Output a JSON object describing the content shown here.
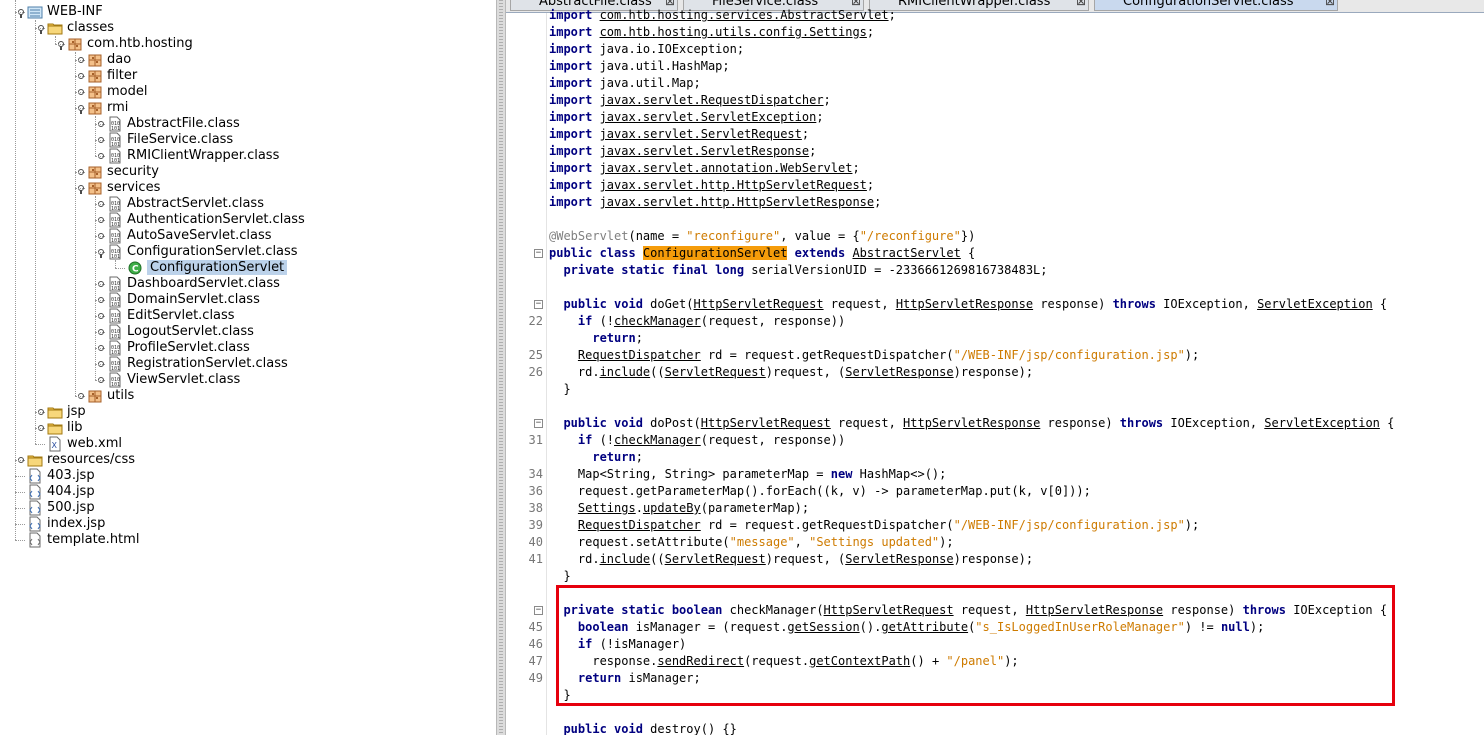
{
  "tree": [
    {
      "label": "WEB-INF",
      "icon": "webinf-folder-icon",
      "depth": 0,
      "state": "open"
    },
    {
      "label": "classes",
      "icon": "folder-icon",
      "depth": 1,
      "state": "open"
    },
    {
      "label": "com.htb.hosting",
      "icon": "package-icon",
      "depth": 2,
      "state": "open"
    },
    {
      "label": "dao",
      "icon": "package-icon",
      "depth": 3,
      "state": "closed"
    },
    {
      "label": "filter",
      "icon": "package-icon",
      "depth": 3,
      "state": "closed"
    },
    {
      "label": "model",
      "icon": "package-icon",
      "depth": 3,
      "state": "closed"
    },
    {
      "label": "rmi",
      "icon": "package-icon",
      "depth": 3,
      "state": "open"
    },
    {
      "label": "AbstractFile.class",
      "icon": "class-file-icon",
      "depth": 4,
      "state": "closed"
    },
    {
      "label": "FileService.class",
      "icon": "class-file-icon",
      "depth": 4,
      "state": "closed"
    },
    {
      "label": "RMIClientWrapper.class",
      "icon": "class-file-icon",
      "depth": 4,
      "state": "closed"
    },
    {
      "label": "security",
      "icon": "package-icon",
      "depth": 3,
      "state": "closed"
    },
    {
      "label": "services",
      "icon": "package-icon",
      "depth": 3,
      "state": "open"
    },
    {
      "label": "AbstractServlet.class",
      "icon": "class-file-icon",
      "depth": 4,
      "state": "closed"
    },
    {
      "label": "AuthenticationServlet.class",
      "icon": "class-file-icon",
      "depth": 4,
      "state": "closed"
    },
    {
      "label": "AutoSaveServlet.class",
      "icon": "class-file-icon",
      "depth": 4,
      "state": "closed"
    },
    {
      "label": "ConfigurationServlet.class",
      "icon": "class-file-icon",
      "depth": 4,
      "state": "open"
    },
    {
      "label": "ConfigurationServlet",
      "icon": "class-icon",
      "depth": 5,
      "state": "leaf",
      "selected": true
    },
    {
      "label": "DashboardServlet.class",
      "icon": "class-file-icon",
      "depth": 4,
      "state": "closed"
    },
    {
      "label": "DomainServlet.class",
      "icon": "class-file-icon",
      "depth": 4,
      "state": "closed"
    },
    {
      "label": "EditServlet.class",
      "icon": "class-file-icon",
      "depth": 4,
      "state": "closed"
    },
    {
      "label": "LogoutServlet.class",
      "icon": "class-file-icon",
      "depth": 4,
      "state": "closed"
    },
    {
      "label": "ProfileServlet.class",
      "icon": "class-file-icon",
      "depth": 4,
      "state": "closed"
    },
    {
      "label": "RegistrationServlet.class",
      "icon": "class-file-icon",
      "depth": 4,
      "state": "closed"
    },
    {
      "label": "ViewServlet.class",
      "icon": "class-file-icon",
      "depth": 4,
      "state": "closed"
    },
    {
      "label": "utils",
      "icon": "package-icon",
      "depth": 3,
      "state": "closed"
    },
    {
      "label": "jsp",
      "icon": "folder-icon",
      "depth": 1,
      "state": "closed"
    },
    {
      "label": "lib",
      "icon": "folder-icon",
      "depth": 1,
      "state": "closed"
    },
    {
      "label": "web.xml",
      "icon": "xml-file-icon",
      "depth": 1,
      "state": "leaf"
    },
    {
      "label": "resources/css",
      "icon": "folder-icon",
      "depth": 0,
      "state": "closed"
    },
    {
      "label": "403.jsp",
      "icon": "jsp-file-icon",
      "depth": 0,
      "state": "leaf"
    },
    {
      "label": "404.jsp",
      "icon": "jsp-file-icon",
      "depth": 0,
      "state": "leaf"
    },
    {
      "label": "500.jsp",
      "icon": "jsp-file-icon",
      "depth": 0,
      "state": "leaf"
    },
    {
      "label": "index.jsp",
      "icon": "jsp-file-icon",
      "depth": 0,
      "state": "leaf"
    },
    {
      "label": "template.html",
      "icon": "html-file-icon",
      "depth": 0,
      "state": "leaf"
    }
  ],
  "tabs": [
    {
      "label": "AbstractFile.class",
      "close": "⊠",
      "active": false
    },
    {
      "label": "FileService.class",
      "close": "⊠",
      "active": false
    },
    {
      "label": "RMIClientWrapper.class",
      "close": "⊠",
      "active": false
    },
    {
      "label": "ConfigurationServlet.class",
      "close": "⊠",
      "active": true
    }
  ],
  "code": [
    {
      "ln": "",
      "fold": "",
      "segs": [
        [
          "kw",
          "import "
        ],
        [
          "u",
          "com.htb.hosting.services.AbstractServlet"
        ],
        [
          "",
          "; "
        ]
      ]
    },
    {
      "ln": "",
      "fold": "",
      "segs": [
        [
          "kw",
          "import "
        ],
        [
          "u",
          "com.htb.hosting.utils.config.Settings"
        ],
        [
          "",
          ";"
        ]
      ]
    },
    {
      "ln": "",
      "fold": "",
      "segs": [
        [
          "kw",
          "import "
        ],
        [
          "",
          "java.io.IOException;"
        ]
      ]
    },
    {
      "ln": "",
      "fold": "",
      "segs": [
        [
          "kw",
          "import "
        ],
        [
          "",
          "java.util.HashMap;"
        ]
      ]
    },
    {
      "ln": "",
      "fold": "",
      "segs": [
        [
          "kw",
          "import "
        ],
        [
          "",
          "java.util.Map;"
        ]
      ]
    },
    {
      "ln": "",
      "fold": "",
      "segs": [
        [
          "kw",
          "import "
        ],
        [
          "u",
          "javax.servlet.RequestDispatcher"
        ],
        [
          "",
          ";"
        ]
      ]
    },
    {
      "ln": "",
      "fold": "",
      "segs": [
        [
          "kw",
          "import "
        ],
        [
          "u",
          "javax.servlet.ServletException"
        ],
        [
          "",
          ";"
        ]
      ]
    },
    {
      "ln": "",
      "fold": "",
      "segs": [
        [
          "kw",
          "import "
        ],
        [
          "u",
          "javax.servlet.ServletRequest"
        ],
        [
          "",
          ";"
        ]
      ]
    },
    {
      "ln": "",
      "fold": "",
      "segs": [
        [
          "kw",
          "import "
        ],
        [
          "u",
          "javax.servlet.ServletResponse"
        ],
        [
          "",
          ";"
        ]
      ]
    },
    {
      "ln": "",
      "fold": "",
      "segs": [
        [
          "kw",
          "import "
        ],
        [
          "u",
          "javax.servlet.annotation.WebServlet"
        ],
        [
          "",
          ";"
        ]
      ]
    },
    {
      "ln": "",
      "fold": "",
      "segs": [
        [
          "kw",
          "import "
        ],
        [
          "u",
          "javax.servlet.http.HttpServletRequest"
        ],
        [
          "",
          ";"
        ]
      ]
    },
    {
      "ln": "",
      "fold": "",
      "segs": [
        [
          "kw",
          "import "
        ],
        [
          "u",
          "javax.servlet.http.HttpServletResponse"
        ],
        [
          "",
          ";"
        ]
      ]
    },
    {
      "ln": "",
      "fold": "",
      "segs": [
        [
          "",
          ""
        ]
      ]
    },
    {
      "ln": "",
      "fold": "",
      "segs": [
        [
          "ann",
          "@WebServlet"
        ],
        [
          "",
          "(name = "
        ],
        [
          "str",
          "\"reconfigure\""
        ],
        [
          "",
          ", value = {"
        ],
        [
          "str",
          "\"/reconfigure\""
        ],
        [
          "",
          "})"
        ]
      ]
    },
    {
      "ln": "",
      "fold": "⊟",
      "segs": [
        [
          "kw",
          "public class "
        ],
        [
          "hl",
          "ConfigurationServlet"
        ],
        [
          "kw",
          " extends "
        ],
        [
          "u",
          "AbstractServlet"
        ],
        [
          "",
          " {"
        ]
      ]
    },
    {
      "ln": "",
      "fold": "",
      "segs": [
        [
          "kw",
          "  private static final long "
        ],
        [
          "",
          "serialVersionUID = -2336661269816738483L;"
        ]
      ]
    },
    {
      "ln": "",
      "fold": "",
      "segs": [
        [
          "",
          ""
        ]
      ]
    },
    {
      "ln": "",
      "fold": "⊟",
      "segs": [
        [
          "kw",
          "  public void "
        ],
        [
          "",
          "doGet("
        ],
        [
          "u",
          "HttpServletRequest"
        ],
        [
          "",
          " request, "
        ],
        [
          "u",
          "HttpServletResponse"
        ],
        [
          "",
          " response) "
        ],
        [
          "kw",
          "throws "
        ],
        [
          "",
          "IOException, "
        ],
        [
          "u",
          "ServletException"
        ],
        [
          "",
          " {"
        ]
      ]
    },
    {
      "ln": "22",
      "fold": "",
      "segs": [
        [
          "kw",
          "    if "
        ],
        [
          "",
          "(!"
        ],
        [
          "u",
          "checkManager"
        ],
        [
          "",
          "(request, response))"
        ]
      ]
    },
    {
      "ln": "",
      "fold": "",
      "segs": [
        [
          "kw",
          "      return"
        ],
        [
          "",
          ";"
        ]
      ]
    },
    {
      "ln": "25",
      "fold": "",
      "segs": [
        [
          "",
          "    "
        ],
        [
          "u",
          "RequestDispatcher"
        ],
        [
          "",
          " rd = request.getRequestDispatcher("
        ],
        [
          "str",
          "\"/WEB-INF/jsp/configuration.jsp\""
        ],
        [
          "",
          ");"
        ]
      ]
    },
    {
      "ln": "26",
      "fold": "",
      "segs": [
        [
          "",
          "    rd."
        ],
        [
          "u",
          "include"
        ],
        [
          "",
          "(("
        ],
        [
          "u",
          "ServletRequest"
        ],
        [
          "",
          ")request, ("
        ],
        [
          "u",
          "ServletResponse"
        ],
        [
          "",
          ")response);"
        ]
      ]
    },
    {
      "ln": "",
      "fold": "",
      "segs": [
        [
          "",
          "  }"
        ]
      ]
    },
    {
      "ln": "",
      "fold": "",
      "segs": [
        [
          "",
          ""
        ]
      ]
    },
    {
      "ln": "",
      "fold": "⊟",
      "segs": [
        [
          "kw",
          "  public void "
        ],
        [
          "",
          "doPost("
        ],
        [
          "u",
          "HttpServletRequest"
        ],
        [
          "",
          " request, "
        ],
        [
          "u",
          "HttpServletResponse"
        ],
        [
          "",
          " response) "
        ],
        [
          "kw",
          "throws "
        ],
        [
          "",
          "IOException, "
        ],
        [
          "u",
          "ServletException"
        ],
        [
          "",
          " {"
        ]
      ]
    },
    {
      "ln": "31",
      "fold": "",
      "segs": [
        [
          "kw",
          "    if "
        ],
        [
          "",
          "(!"
        ],
        [
          "u",
          "checkManager"
        ],
        [
          "",
          "(request, response))"
        ]
      ]
    },
    {
      "ln": "",
      "fold": "",
      "segs": [
        [
          "kw",
          "      return"
        ],
        [
          "",
          ";"
        ]
      ]
    },
    {
      "ln": "34",
      "fold": "",
      "segs": [
        [
          "",
          "    Map<String, String> parameterMap = "
        ],
        [
          "kw",
          "new "
        ],
        [
          "",
          "HashMap<>();"
        ]
      ]
    },
    {
      "ln": "36",
      "fold": "",
      "segs": [
        [
          "",
          "    request.getParameterMap().forEach((k, v) -> parameterMap.put(k, v[0]));"
        ]
      ]
    },
    {
      "ln": "38",
      "fold": "",
      "segs": [
        [
          "",
          "    "
        ],
        [
          "u",
          "Settings"
        ],
        [
          "",
          "."
        ],
        [
          "u",
          "updateBy"
        ],
        [
          "",
          "(parameterMap);"
        ]
      ]
    },
    {
      "ln": "39",
      "fold": "",
      "segs": [
        [
          "",
          "    "
        ],
        [
          "u",
          "RequestDispatcher"
        ],
        [
          "",
          " rd = request.getRequestDispatcher("
        ],
        [
          "str",
          "\"/WEB-INF/jsp/configuration.jsp\""
        ],
        [
          "",
          ");"
        ]
      ]
    },
    {
      "ln": "40",
      "fold": "",
      "segs": [
        [
          "",
          "    request.setAttribute("
        ],
        [
          "str",
          "\"message\""
        ],
        [
          "",
          ", "
        ],
        [
          "str",
          "\"Settings updated\""
        ],
        [
          "",
          ");"
        ]
      ]
    },
    {
      "ln": "41",
      "fold": "",
      "segs": [
        [
          "",
          "    rd."
        ],
        [
          "u",
          "include"
        ],
        [
          "",
          "(("
        ],
        [
          "u",
          "ServletRequest"
        ],
        [
          "",
          ")request, ("
        ],
        [
          "u",
          "ServletResponse"
        ],
        [
          "",
          ")response);"
        ]
      ]
    },
    {
      "ln": "",
      "fold": "",
      "segs": [
        [
          "",
          "  }"
        ]
      ]
    },
    {
      "ln": "",
      "fold": "",
      "segs": [
        [
          "",
          ""
        ]
      ]
    },
    {
      "ln": "",
      "fold": "⊟",
      "segs": [
        [
          "kw",
          "  private static boolean "
        ],
        [
          "",
          "checkManager("
        ],
        [
          "u",
          "HttpServletRequest"
        ],
        [
          "",
          " request, "
        ],
        [
          "u",
          "HttpServletResponse"
        ],
        [
          "",
          " response) "
        ],
        [
          "kw",
          "throws "
        ],
        [
          "",
          "IOException {"
        ]
      ]
    },
    {
      "ln": "45",
      "fold": "",
      "segs": [
        [
          "kw",
          "    boolean "
        ],
        [
          "",
          "isManager = (request."
        ],
        [
          "u",
          "getSession"
        ],
        [
          "",
          "()."
        ],
        [
          "u",
          "getAttribute"
        ],
        [
          "",
          "("
        ],
        [
          "str",
          "\"s_IsLoggedInUserRoleManager\""
        ],
        [
          "",
          ") != "
        ],
        [
          "kw",
          "null"
        ],
        [
          "",
          ");"
        ]
      ]
    },
    {
      "ln": "46",
      "fold": "",
      "segs": [
        [
          "kw",
          "    if "
        ],
        [
          "",
          "(!isManager)"
        ]
      ]
    },
    {
      "ln": "47",
      "fold": "",
      "segs": [
        [
          "",
          "      response."
        ],
        [
          "u",
          "sendRedirect"
        ],
        [
          "",
          "(request."
        ],
        [
          "u",
          "getContextPath"
        ],
        [
          "",
          "() + "
        ],
        [
          "str",
          "\"/panel\""
        ],
        [
          "",
          ");"
        ]
      ]
    },
    {
      "ln": "49",
      "fold": "",
      "segs": [
        [
          "kw",
          "    return "
        ],
        [
          "",
          "isManager;"
        ]
      ]
    },
    {
      "ln": "",
      "fold": "",
      "segs": [
        [
          "",
          "  }"
        ]
      ]
    },
    {
      "ln": "",
      "fold": "",
      "segs": [
        [
          "",
          ""
        ]
      ]
    },
    {
      "ln": "",
      "fold": "",
      "segs": [
        [
          "kw",
          "  public void "
        ],
        [
          "",
          "destroy() {}"
        ]
      ]
    }
  ],
  "colors": {
    "keyword": "#000080",
    "string": "#ce7b00",
    "highlight": "#f59c0a",
    "callout": "#e6000d",
    "selection": "#bcd2ea"
  }
}
